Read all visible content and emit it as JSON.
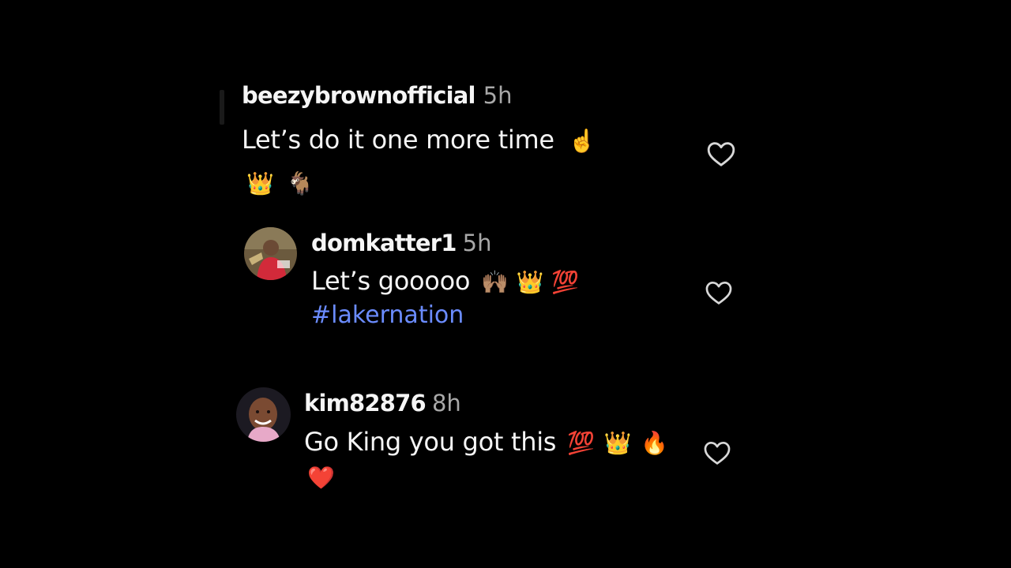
{
  "comments": [
    {
      "username": "beezybrownofficial",
      "time": "5h",
      "text": "Let’s do it one more time",
      "emoji_line1": "☝️",
      "emoji_line2": [
        "👑",
        "🐐"
      ],
      "like_icon": "heart-outline-icon"
    },
    {
      "username": "domkatter1",
      "time": "5h",
      "text": "Let’s gooooo",
      "emojis": [
        "🙌🏽",
        "👑",
        "💯"
      ],
      "hashtag": "#lakernation",
      "like_icon": "heart-outline-icon",
      "avatar": "avatar"
    },
    {
      "username": "kim82876",
      "time": "8h",
      "text": "Go King you got this",
      "emojis": [
        "💯",
        "👑",
        "🔥"
      ],
      "emoji_line2": [
        "❤️"
      ],
      "like_icon": "heart-outline-icon",
      "avatar": "avatar"
    }
  ],
  "colors": {
    "background": "#000000",
    "text": "#f5f5f5",
    "timestamp": "#a8a8a8",
    "hashtag": "#6b8cff"
  }
}
